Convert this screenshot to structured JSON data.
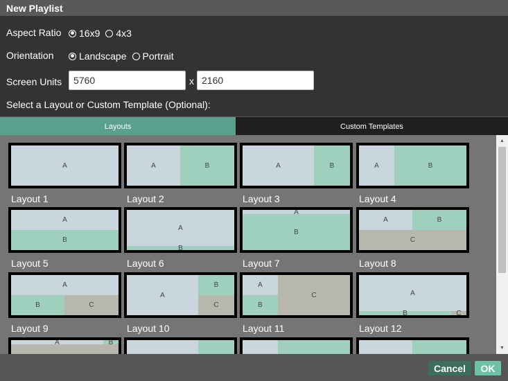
{
  "window": {
    "title": "New Playlist"
  },
  "form": {
    "aspect_ratio": {
      "label": "Aspect Ratio",
      "options": [
        "16x9",
        "4x3"
      ],
      "selected": "16x9"
    },
    "orientation": {
      "label": "Orientation",
      "options": [
        "Landscape",
        "Portrait"
      ],
      "selected": "Landscape"
    },
    "screen_units": {
      "label": "Screen Units",
      "width": "5760",
      "height": "2160",
      "separator": "x"
    },
    "select_prompt": "Select a Layout or Custom Template (Optional):"
  },
  "tabs": {
    "layouts": "Layouts",
    "custom_templates": "Custom Templates",
    "active": "layouts"
  },
  "colors": {
    "accent": "#5aa18d",
    "zone_a": "#c9d6de",
    "zone_b": "#9fd0be",
    "zone_c": "#b8b7ad"
  },
  "layouts": [
    {
      "label": "Layout 1"
    },
    {
      "label": "Layout 2"
    },
    {
      "label": "Layout 3"
    },
    {
      "label": "Layout 4"
    },
    {
      "label": "Layout 5"
    },
    {
      "label": "Layout 6"
    },
    {
      "label": "Layout 7"
    },
    {
      "label": "Layout 8"
    },
    {
      "label": "Layout 9"
    },
    {
      "label": "Layout 10"
    },
    {
      "label": "Layout 11"
    },
    {
      "label": "Layout 12"
    }
  ],
  "zones": {
    "a": "A",
    "b": "B",
    "c": "C"
  },
  "footer": {
    "cancel": "Cancel",
    "ok": "OK"
  }
}
